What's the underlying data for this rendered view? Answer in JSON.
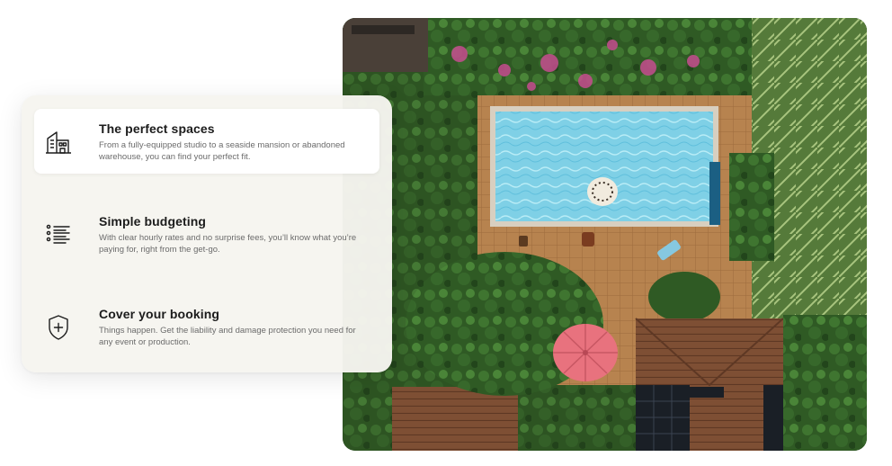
{
  "features": [
    {
      "title": "The perfect spaces",
      "description": "From a fully-equipped studio to a seaside mansion or abandoned warehouse, you can find your perfect fit.",
      "icon": "building-icon",
      "active": true
    },
    {
      "title": "Simple budgeting",
      "description": "With clear hourly rates and no surprise fees, you’ll know what you’re paying for, right from the get-go.",
      "icon": "list-icon",
      "active": false
    },
    {
      "title": "Cover your booking",
      "description": "Things happen. Get the liability and damage protection you need for any event or production.",
      "icon": "shield-plus-icon",
      "active": false
    }
  ],
  "colors": {
    "card_bg": "#f6f5f0",
    "active_bg": "#ffffff",
    "title": "#1c1c1c",
    "text_muted": "#6b6b6b",
    "pool_water": "#7fd0e6",
    "umbrella": "#e8727e"
  }
}
